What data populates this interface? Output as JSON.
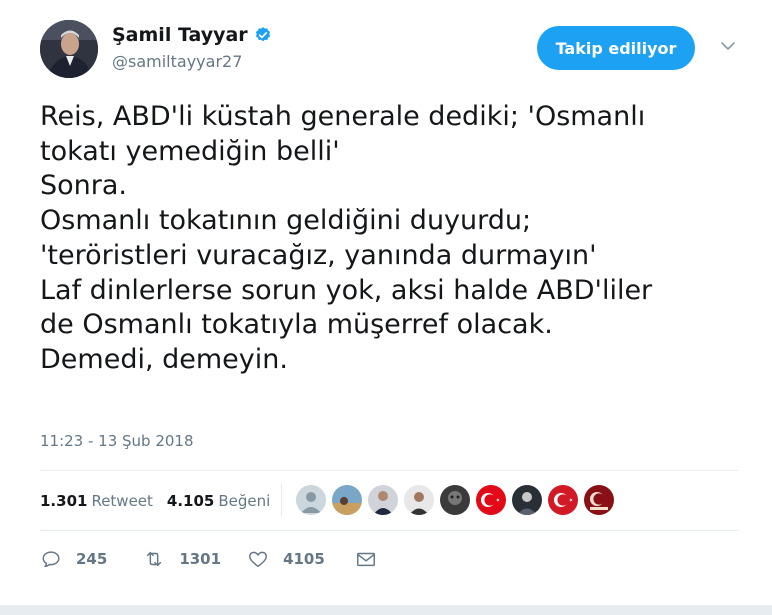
{
  "user": {
    "display_name": "Şamil Tayyar",
    "handle": "@samiltayyar27",
    "verified_icon": "verified-badge-icon",
    "follow_button_label": "Takip ediliyor"
  },
  "tweet": {
    "lines": [
      "Reis, ABD'li küstah generale dediki; 'Osmanlı",
      "tokatı yemediğin belli'",
      "Sonra.",
      "Osmanlı tokatının geldiğini duyurdu;",
      "'teröristleri vuracağız, yanında durmayın'",
      "Laf dinlerlerse sorun yok, aksi halde ABD'liler",
      "de Osmanlı tokatıyla müşerref olacak.",
      "Demedi, demeyin."
    ],
    "timestamp": "11:23 - 13 Şub 2018"
  },
  "stats": {
    "retweets_count": "1.301",
    "retweets_label": "Retweet",
    "likes_count": "4.105",
    "likes_label": "Beğeni"
  },
  "actions": {
    "reply_count": "245",
    "retweet_count": "1301",
    "like_count": "4105"
  },
  "colors": {
    "accent": "#1da1f2",
    "text": "#14171a",
    "secondary": "#657786",
    "divider": "#e6ecf0"
  }
}
